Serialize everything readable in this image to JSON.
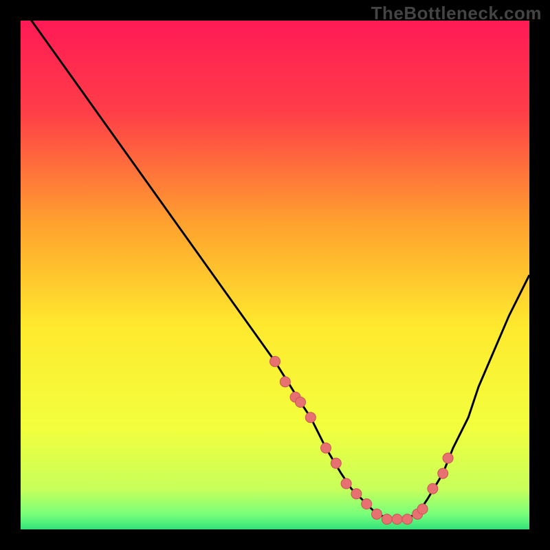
{
  "watermark": "TheBottleneck.com",
  "colors": {
    "gradient_stops": [
      {
        "offset": 0.0,
        "color": "#ff1a55"
      },
      {
        "offset": 0.18,
        "color": "#ff3e48"
      },
      {
        "offset": 0.4,
        "color": "#ffa22e"
      },
      {
        "offset": 0.6,
        "color": "#ffe92e"
      },
      {
        "offset": 0.8,
        "color": "#f2ff3d"
      },
      {
        "offset": 0.92,
        "color": "#c8ff5a"
      },
      {
        "offset": 0.97,
        "color": "#78ff7a"
      },
      {
        "offset": 1.0,
        "color": "#31e27a"
      }
    ],
    "curve": "#000000",
    "dot_fill": "#e77070",
    "dot_stroke": "#c95555"
  },
  "chart_data": {
    "type": "line",
    "title": "",
    "xlabel": "",
    "ylabel": "",
    "xlim": [
      0,
      100
    ],
    "ylim": [
      0,
      100
    ],
    "series": [
      {
        "name": "bottleneck-curve",
        "x": [
          0,
          5,
          10,
          15,
          20,
          25,
          30,
          35,
          40,
          45,
          50,
          55,
          57,
          60,
          63,
          65,
          68,
          70,
          73,
          75,
          78,
          80,
          83,
          85,
          88,
          90,
          93,
          96,
          100
        ],
        "y": [
          103,
          96,
          89,
          82,
          75,
          68,
          61,
          54,
          47,
          40,
          33,
          25,
          22,
          16,
          11,
          8,
          5,
          3,
          2,
          2,
          3,
          6,
          11,
          16,
          22,
          28,
          35,
          42,
          50
        ]
      }
    ],
    "dots": {
      "name": "highlight-dots",
      "x": [
        50,
        52,
        54,
        55,
        57,
        60,
        62,
        64,
        66,
        68,
        70,
        72,
        74,
        76,
        78,
        79,
        81,
        83,
        84
      ],
      "y": [
        33,
        29,
        26,
        25,
        22,
        16,
        13,
        9,
        7,
        5,
        3,
        2,
        2,
        2,
        3,
        4,
        8,
        11,
        14
      ]
    }
  }
}
